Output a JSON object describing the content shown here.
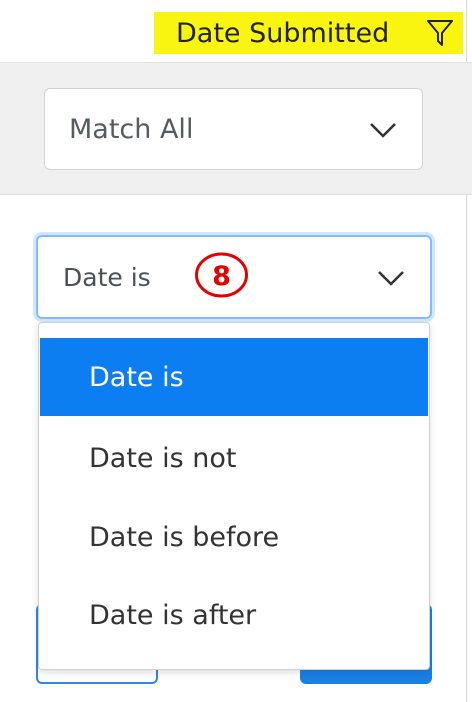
{
  "header": {
    "label": "Date Submitted",
    "icon": "filter-icon",
    "highlight_color": "#f9f510"
  },
  "match_select": {
    "value": "Match All",
    "icon": "chevron-down-icon"
  },
  "condition_select": {
    "value": "Date is",
    "icon": "chevron-down-icon",
    "annotation": "8"
  },
  "dropdown": {
    "options": [
      "Date is",
      "Date is not",
      "Date is before",
      "Date is after"
    ],
    "selected_index": 0,
    "active_color": "#0d7df2"
  }
}
